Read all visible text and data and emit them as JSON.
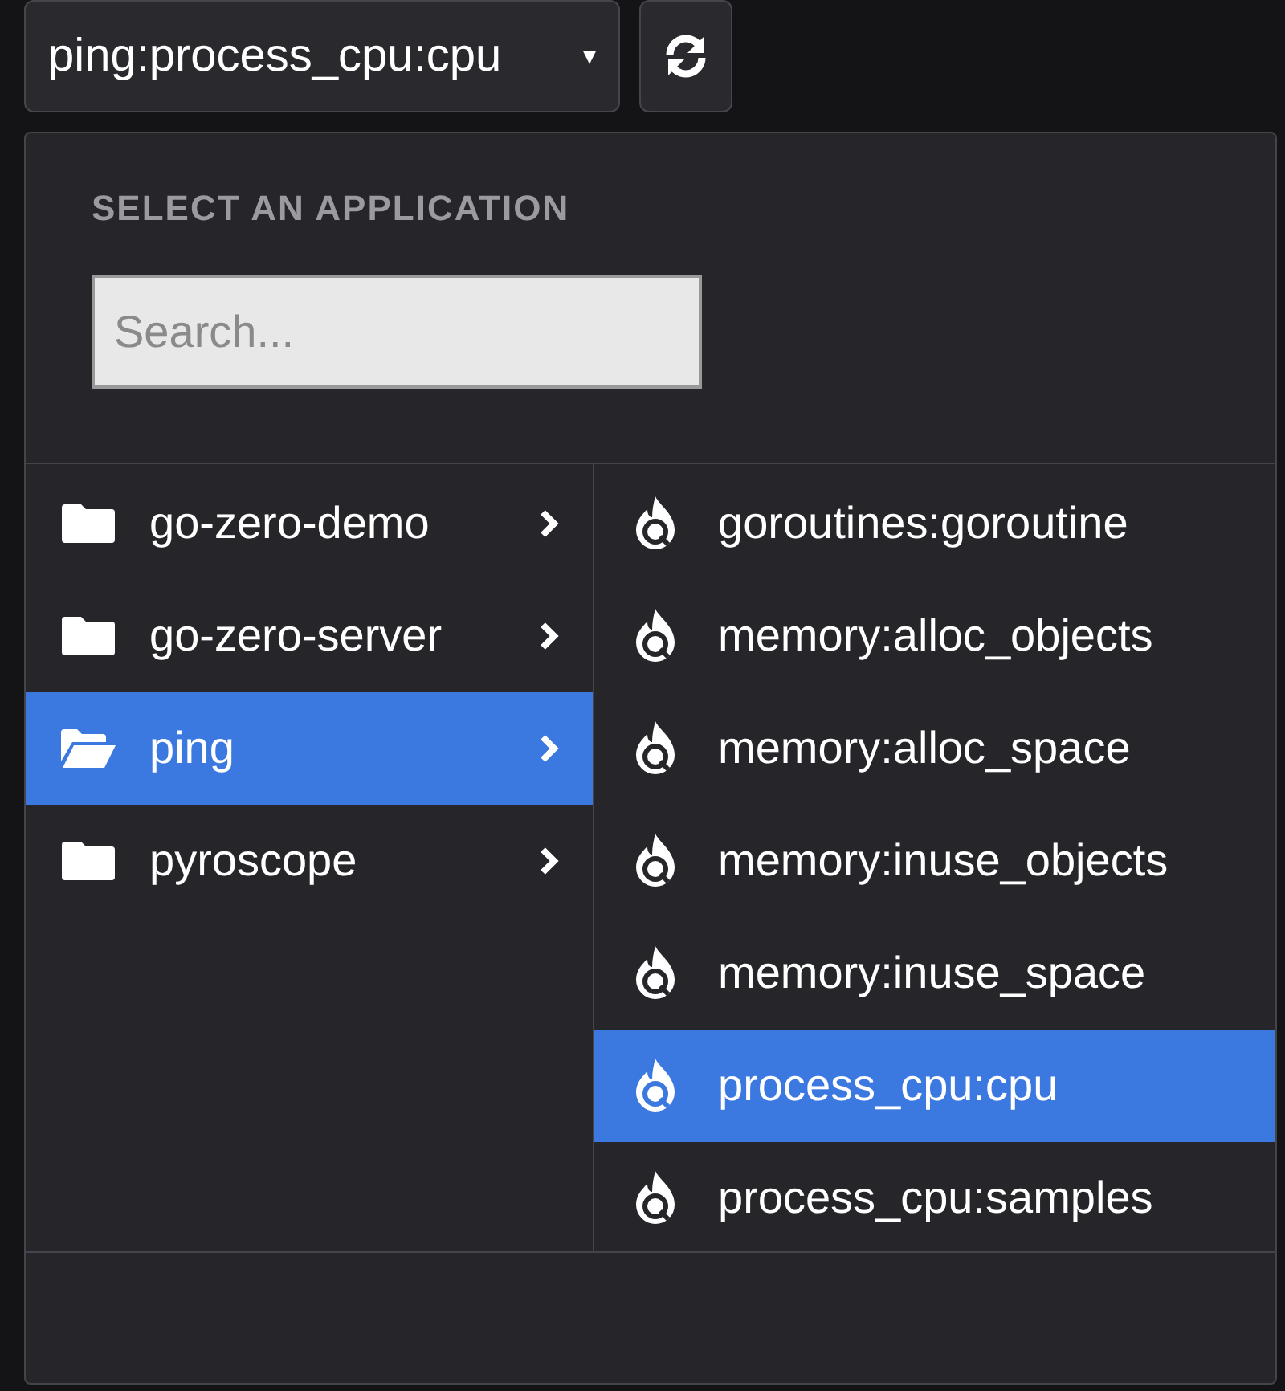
{
  "selector": {
    "value": "ping:process_cpu:cpu",
    "caret": "▾"
  },
  "popup": {
    "heading": "SELECT AN APPLICATION",
    "search": {
      "placeholder": "Search..."
    },
    "apps": [
      {
        "label": "go-zero-demo",
        "selected": false
      },
      {
        "label": "go-zero-server",
        "selected": false
      },
      {
        "label": "ping",
        "selected": true
      },
      {
        "label": "pyroscope",
        "selected": false
      }
    ],
    "profiles": [
      {
        "label": "goroutines:goroutine",
        "selected": false
      },
      {
        "label": "memory:alloc_objects",
        "selected": false
      },
      {
        "label": "memory:alloc_space",
        "selected": false
      },
      {
        "label": "memory:inuse_objects",
        "selected": false
      },
      {
        "label": "memory:inuse_space",
        "selected": false
      },
      {
        "label": "process_cpu:cpu",
        "selected": true
      },
      {
        "label": "process_cpu:samples",
        "selected": false
      }
    ]
  }
}
